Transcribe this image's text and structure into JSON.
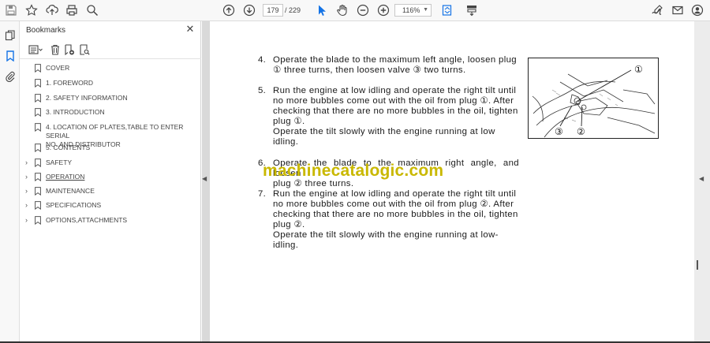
{
  "toolbar": {
    "page_current": "179",
    "page_total": "/  229",
    "zoom": "116%",
    "icons": [
      "save-icon",
      "bookmark-star-icon",
      "upload-icon",
      "print-icon",
      "search-icon",
      "page-up-icon",
      "page-down-icon",
      "select-cursor-icon",
      "hand-icon",
      "zoom-out-icon",
      "zoom-in-icon",
      "fit-page-icon",
      "marquee-icon",
      "sign-icon",
      "mail-icon",
      "account-icon"
    ]
  },
  "sidebar": {
    "title": "Bookmarks",
    "items": [
      {
        "label": "COVER",
        "expandable": false
      },
      {
        "label": "1. FOREWORD",
        "expandable": false
      },
      {
        "label": "2. SAFETY INFORMATION",
        "expandable": false
      },
      {
        "label": "3. INTRODUCTION",
        "expandable": false
      },
      {
        "label": "4. LOCATION OF PLATES,TABLE TO ENTER SERIAL",
        "label2": "NO. AND DISTRIBUTOR",
        "expandable": false
      },
      {
        "label": "5. CONTENTS",
        "expandable": false
      },
      {
        "label": "SAFETY",
        "expandable": true
      },
      {
        "label": "OPERATION",
        "expandable": true,
        "active": true
      },
      {
        "label": "MAINTENANCE",
        "expandable": true
      },
      {
        "label": "SPECIFICATIONS",
        "expandable": true
      },
      {
        "label": "OPTIONS,ATTACHMENTS",
        "expandable": true
      }
    ]
  },
  "document": {
    "steps": [
      {
        "num": "4.",
        "lines": [
          "Operate the blade to the maximum left angle, loosen plug",
          "① three turns, then loosen valve ③ two turns."
        ]
      },
      {
        "num": "5.",
        "lines": [
          "Run the engine at low idling and operate the right tilt until",
          "no more bubbles come out with the oil from plug ①. After",
          "checking that there are no more bubbles in the oil, tighten",
          "plug ①.",
          "Operate the tilt slowly with the engine running at low",
          "idling."
        ]
      },
      {
        "num": "6.",
        "lines": [
          "Operate the blade to the maximum right angle, and loosen",
          "plug ② three turns."
        ]
      },
      {
        "num": "7.",
        "lines": [
          "Run the engine at low idling and operate the right tilt until",
          "no more bubbles come out with the oil from plug ②. After",
          "checking that there are no more bubbles in the oil, tighten",
          "plug ②.",
          "Operate the tilt slowly with the engine running at low-",
          "idling."
        ]
      }
    ],
    "figure_callouts": [
      "①",
      "③",
      "②"
    ],
    "watermark": "machinecatalogic.com"
  }
}
